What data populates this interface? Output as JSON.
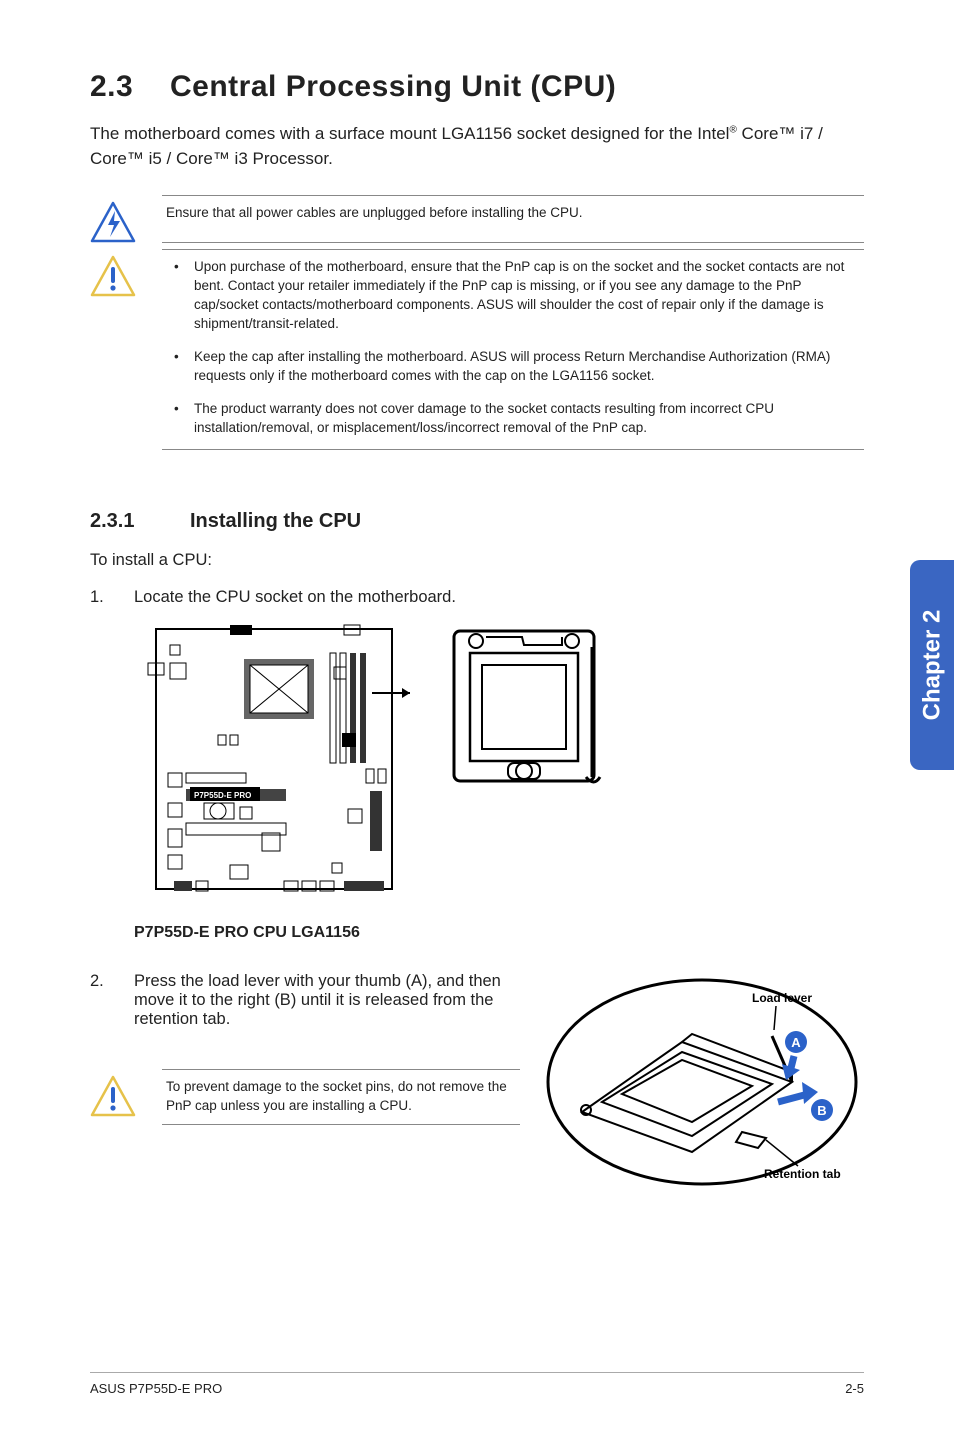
{
  "section": {
    "number": "2.3",
    "title": "Central Processing Unit (CPU)"
  },
  "intro": {
    "line1": "The motherboard comes with a surface mount LGA1156 socket designed for the Intel",
    "reg": "®",
    "line2": "Core™ i7 / Core™ i5 / Core™ i3 Processor."
  },
  "callout_danger": "Ensure that all power cables are unplugged before installing the CPU.",
  "callout_caution": [
    "Upon purchase of the motherboard, ensure that the PnP cap is on the socket and the socket contacts are not bent. Contact your retailer immediately if the PnP cap is missing, or if you see any damage to the PnP cap/socket contacts/motherboard components. ASUS will shoulder the cost of repair only if the damage is shipment/transit-related.",
    "Keep the cap after installing the motherboard. ASUS will process Return Merchandise Authorization (RMA) requests only if the motherboard comes with the cap on the LGA1156 socket.",
    "The product warranty does not cover damage to the socket contacts resulting from incorrect CPU installation/removal, or misplacement/loss/incorrect removal of the PnP cap."
  ],
  "subsection": {
    "number": "2.3.1",
    "title": "Installing the CPU"
  },
  "install_lead": "To install a CPU:",
  "steps": {
    "s1_num": "1.",
    "s1_text": "Locate the CPU socket on the motherboard.",
    "s2_num": "2.",
    "s2_text": "Press the load lever with your thumb (A), and then move it to the right (B) until it is released from the retention tab."
  },
  "board": {
    "label": "P7P55D-E PRO",
    "caption": "P7P55D-E PRO CPU LGA1156"
  },
  "small_callout": "To prevent damage to the socket pins, do not remove the PnP cap unless you are installing a CPU.",
  "socket_diagram": {
    "load_lever": "Load lever",
    "retention_tab": "Retention tab",
    "a": "A",
    "b": "B"
  },
  "side_tab": "Chapter 2",
  "footer": {
    "left": "ASUS P7P55D-E PRO",
    "right": "2-5"
  }
}
